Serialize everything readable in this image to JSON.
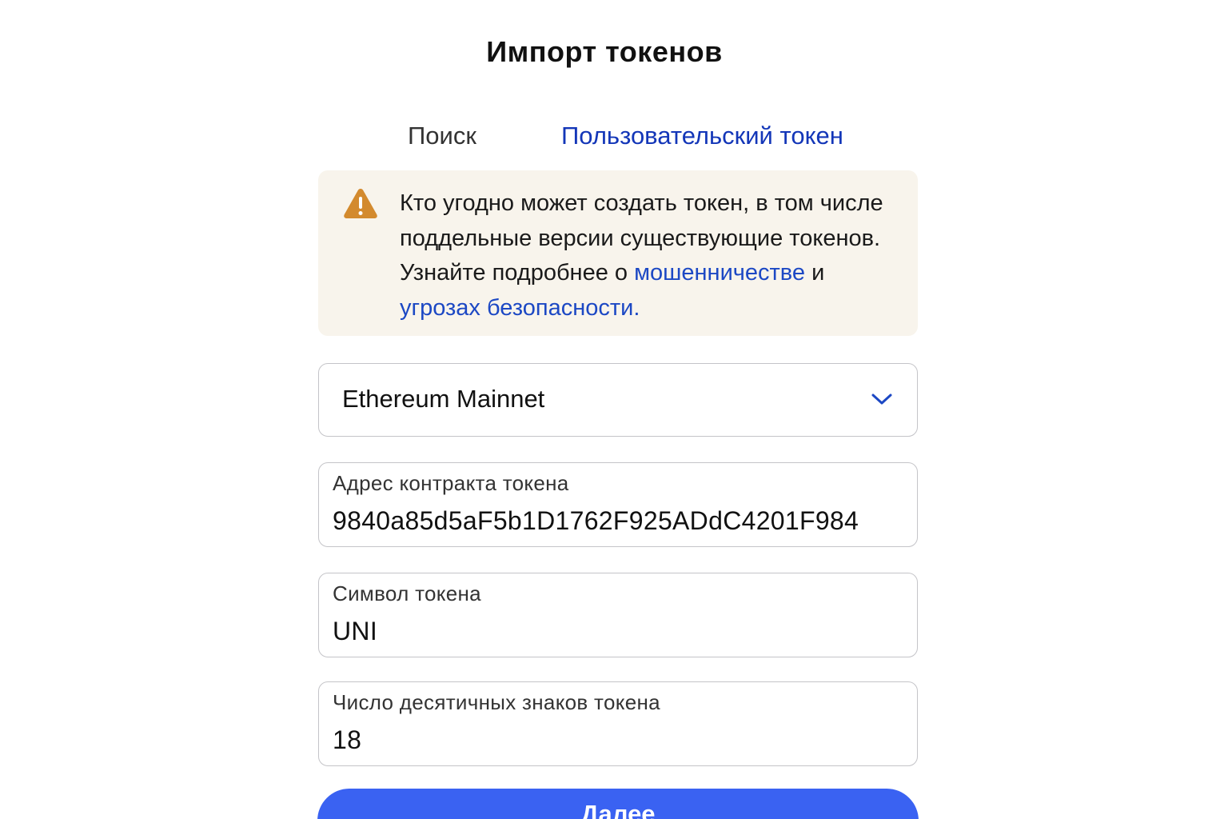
{
  "header": {
    "title": "Импорт токенов"
  },
  "tabs": [
    {
      "label": "Поиск",
      "active": false
    },
    {
      "label": "Пользовательский токен",
      "active": true
    }
  ],
  "warning": {
    "icon": "warning-triangle-icon",
    "text": "Кто угодно может создать токен, в том числе поддельные версии существующие токенов. Узнайте подробнее о",
    "link1": "мошенничестве",
    "connector": "и",
    "link2": "угрозах безопасности."
  },
  "network_select": {
    "value": "Ethereum Mainnet",
    "icon": "chevron-down-icon"
  },
  "fields": {
    "contract_address": {
      "label": "Адрес контракта токена",
      "value": "9840a85d5aF5b1D1762F925ADdC4201F984"
    },
    "symbol": {
      "label": "Символ токена",
      "value": "UNI"
    },
    "decimals": {
      "label": "Число десятичных знаков токена",
      "value": "18"
    }
  },
  "actions": {
    "next_label": "Далее"
  },
  "colors": {
    "accent": "#3a62f2",
    "link": "#1c48c4",
    "tab_active": "#1336b8",
    "warning_bg": "#f8f4ec",
    "warning_icon": "#d38a2e"
  }
}
